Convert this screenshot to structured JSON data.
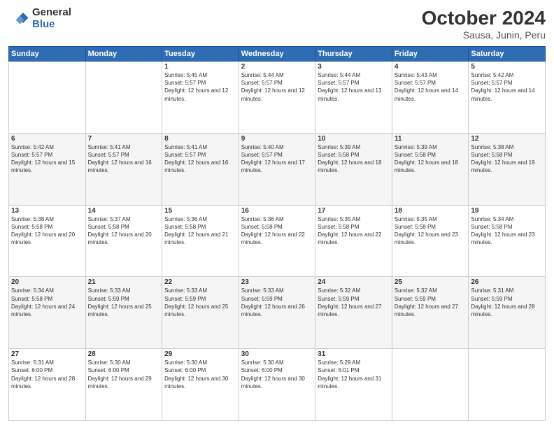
{
  "logo": {
    "general": "General",
    "blue": "Blue"
  },
  "title": "October 2024",
  "subtitle": "Sausa, Junin, Peru",
  "days_of_week": [
    "Sunday",
    "Monday",
    "Tuesday",
    "Wednesday",
    "Thursday",
    "Friday",
    "Saturday"
  ],
  "weeks": [
    [
      {
        "day": "",
        "sunrise": "",
        "sunset": "",
        "daylight": ""
      },
      {
        "day": "",
        "sunrise": "",
        "sunset": "",
        "daylight": ""
      },
      {
        "day": "1",
        "sunrise": "Sunrise: 5:45 AM",
        "sunset": "Sunset: 5:57 PM",
        "daylight": "Daylight: 12 hours and 12 minutes."
      },
      {
        "day": "2",
        "sunrise": "Sunrise: 5:44 AM",
        "sunset": "Sunset: 5:57 PM",
        "daylight": "Daylight: 12 hours and 12 minutes."
      },
      {
        "day": "3",
        "sunrise": "Sunrise: 5:44 AM",
        "sunset": "Sunset: 5:57 PM",
        "daylight": "Daylight: 12 hours and 13 minutes."
      },
      {
        "day": "4",
        "sunrise": "Sunrise: 5:43 AM",
        "sunset": "Sunset: 5:57 PM",
        "daylight": "Daylight: 12 hours and 14 minutes."
      },
      {
        "day": "5",
        "sunrise": "Sunrise: 5:42 AM",
        "sunset": "Sunset: 5:57 PM",
        "daylight": "Daylight: 12 hours and 14 minutes."
      }
    ],
    [
      {
        "day": "6",
        "sunrise": "Sunrise: 5:42 AM",
        "sunset": "Sunset: 5:57 PM",
        "daylight": "Daylight: 12 hours and 15 minutes."
      },
      {
        "day": "7",
        "sunrise": "Sunrise: 5:41 AM",
        "sunset": "Sunset: 5:57 PM",
        "daylight": "Daylight: 12 hours and 16 minutes."
      },
      {
        "day": "8",
        "sunrise": "Sunrise: 5:41 AM",
        "sunset": "Sunset: 5:57 PM",
        "daylight": "Daylight: 12 hours and 16 minutes."
      },
      {
        "day": "9",
        "sunrise": "Sunrise: 5:40 AM",
        "sunset": "Sunset: 5:57 PM",
        "daylight": "Daylight: 12 hours and 17 minutes."
      },
      {
        "day": "10",
        "sunrise": "Sunrise: 5:39 AM",
        "sunset": "Sunset: 5:58 PM",
        "daylight": "Daylight: 12 hours and 18 minutes."
      },
      {
        "day": "11",
        "sunrise": "Sunrise: 5:39 AM",
        "sunset": "Sunset: 5:58 PM",
        "daylight": "Daylight: 12 hours and 18 minutes."
      },
      {
        "day": "12",
        "sunrise": "Sunrise: 5:38 AM",
        "sunset": "Sunset: 5:58 PM",
        "daylight": "Daylight: 12 hours and 19 minutes."
      }
    ],
    [
      {
        "day": "13",
        "sunrise": "Sunrise: 5:38 AM",
        "sunset": "Sunset: 5:58 PM",
        "daylight": "Daylight: 12 hours and 20 minutes."
      },
      {
        "day": "14",
        "sunrise": "Sunrise: 5:37 AM",
        "sunset": "Sunset: 5:58 PM",
        "daylight": "Daylight: 12 hours and 20 minutes."
      },
      {
        "day": "15",
        "sunrise": "Sunrise: 5:36 AM",
        "sunset": "Sunset: 5:58 PM",
        "daylight": "Daylight: 12 hours and 21 minutes."
      },
      {
        "day": "16",
        "sunrise": "Sunrise: 5:36 AM",
        "sunset": "Sunset: 5:58 PM",
        "daylight": "Daylight: 12 hours and 22 minutes."
      },
      {
        "day": "17",
        "sunrise": "Sunrise: 5:35 AM",
        "sunset": "Sunset: 5:58 PM",
        "daylight": "Daylight: 12 hours and 22 minutes."
      },
      {
        "day": "18",
        "sunrise": "Sunrise: 5:35 AM",
        "sunset": "Sunset: 5:58 PM",
        "daylight": "Daylight: 12 hours and 23 minutes."
      },
      {
        "day": "19",
        "sunrise": "Sunrise: 5:34 AM",
        "sunset": "Sunset: 5:58 PM",
        "daylight": "Daylight: 12 hours and 23 minutes."
      }
    ],
    [
      {
        "day": "20",
        "sunrise": "Sunrise: 5:34 AM",
        "sunset": "Sunset: 5:58 PM",
        "daylight": "Daylight: 12 hours and 24 minutes."
      },
      {
        "day": "21",
        "sunrise": "Sunrise: 5:33 AM",
        "sunset": "Sunset: 5:59 PM",
        "daylight": "Daylight: 12 hours and 25 minutes."
      },
      {
        "day": "22",
        "sunrise": "Sunrise: 5:33 AM",
        "sunset": "Sunset: 5:59 PM",
        "daylight": "Daylight: 12 hours and 25 minutes."
      },
      {
        "day": "23",
        "sunrise": "Sunrise: 5:33 AM",
        "sunset": "Sunset: 5:59 PM",
        "daylight": "Daylight: 12 hours and 26 minutes."
      },
      {
        "day": "24",
        "sunrise": "Sunrise: 5:32 AM",
        "sunset": "Sunset: 5:59 PM",
        "daylight": "Daylight: 12 hours and 27 minutes."
      },
      {
        "day": "25",
        "sunrise": "Sunrise: 5:32 AM",
        "sunset": "Sunset: 5:59 PM",
        "daylight": "Daylight: 12 hours and 27 minutes."
      },
      {
        "day": "26",
        "sunrise": "Sunrise: 5:31 AM",
        "sunset": "Sunset: 5:59 PM",
        "daylight": "Daylight: 12 hours and 28 minutes."
      }
    ],
    [
      {
        "day": "27",
        "sunrise": "Sunrise: 5:31 AM",
        "sunset": "Sunset: 6:00 PM",
        "daylight": "Daylight: 12 hours and 28 minutes."
      },
      {
        "day": "28",
        "sunrise": "Sunrise: 5:30 AM",
        "sunset": "Sunset: 6:00 PM",
        "daylight": "Daylight: 12 hours and 29 minutes."
      },
      {
        "day": "29",
        "sunrise": "Sunrise: 5:30 AM",
        "sunset": "Sunset: 6:00 PM",
        "daylight": "Daylight: 12 hours and 30 minutes."
      },
      {
        "day": "30",
        "sunrise": "Sunrise: 5:30 AM",
        "sunset": "Sunset: 6:00 PM",
        "daylight": "Daylight: 12 hours and 30 minutes."
      },
      {
        "day": "31",
        "sunrise": "Sunrise: 5:29 AM",
        "sunset": "Sunset: 6:01 PM",
        "daylight": "Daylight: 12 hours and 31 minutes."
      },
      {
        "day": "",
        "sunrise": "",
        "sunset": "",
        "daylight": ""
      },
      {
        "day": "",
        "sunrise": "",
        "sunset": "",
        "daylight": ""
      }
    ]
  ]
}
